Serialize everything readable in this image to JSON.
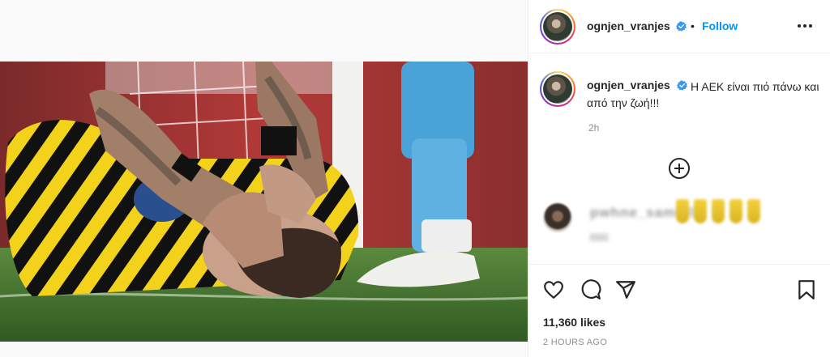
{
  "post": {
    "username": "ognjen_vranjes",
    "verified": true,
    "follow_label": "Follow",
    "separator": "•",
    "caption": "Η ΑΕΚ είναι πιό πάνω και από την ζωή!!!",
    "caption_time": "2h",
    "likes": "11,360 likes",
    "timestamp": "2 HOURS AGO"
  },
  "comment": {
    "author_blurred": "pwhne_samslll",
    "text_blurred": "lllll"
  },
  "icons": {
    "verified": "verified-badge-icon",
    "more": "more-options-icon",
    "load_more": "plus-circle-icon",
    "like": "heart-icon",
    "comment": "comment-bubble-icon",
    "share": "paper-plane-icon",
    "save": "bookmark-icon"
  },
  "colors": {
    "accent": "#0095f6",
    "text": "#262626",
    "muted": "#8e8e8e",
    "divider": "#efefef",
    "jersey_yellow": "#f2d21a",
    "pitch_green": "#3f6e2c"
  }
}
